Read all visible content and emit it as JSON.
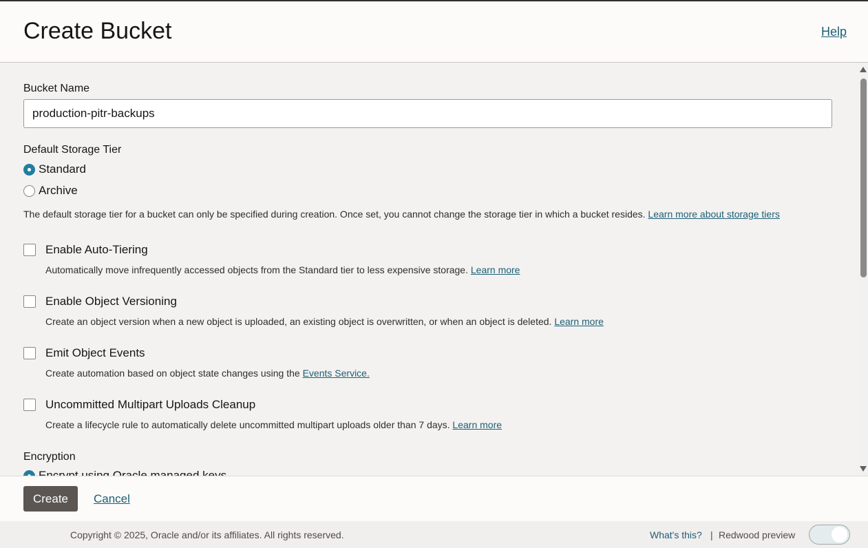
{
  "header": {
    "title": "Create Bucket",
    "help_label": "Help"
  },
  "form": {
    "bucket_name_label": "Bucket Name",
    "bucket_name_value": "production-pitr-backups",
    "storage_tier": {
      "label": "Default Storage Tier",
      "options": [
        {
          "label": "Standard",
          "selected": true
        },
        {
          "label": "Archive",
          "selected": false
        }
      ],
      "help_text": "The default storage tier for a bucket can only be specified during creation. Once set, you cannot change the storage tier in which a bucket resides.",
      "help_link": "Learn more about storage tiers"
    },
    "options": [
      {
        "label": "Enable Auto-Tiering",
        "checked": false,
        "description": "Automatically move infrequently accessed objects from the Standard tier to less expensive storage.",
        "link": "Learn more"
      },
      {
        "label": "Enable Object Versioning",
        "checked": false,
        "description": "Create an object version when a new object is uploaded, an existing object is overwritten, or when an object is deleted.",
        "link": "Learn more"
      },
      {
        "label": "Emit Object Events",
        "checked": false,
        "description": "Create automation based on object state changes using the",
        "link": "Events Service."
      },
      {
        "label": "Uncommitted Multipart Uploads Cleanup",
        "checked": false,
        "description": "Create a lifecycle rule to automatically delete uncommitted multipart uploads older than 7 days.",
        "link": "Learn more"
      }
    ],
    "encryption": {
      "label": "Encryption",
      "options": [
        {
          "label": "Encrypt using Oracle managed keys",
          "selected": true
        }
      ]
    }
  },
  "actions": {
    "create_label": "Create",
    "cancel_label": "Cancel"
  },
  "footer": {
    "copyright": "Copyright © 2025, Oracle and/or its affiliates. All rights reserved.",
    "whats_this": "What's this?",
    "separator": "|",
    "redwood_label": "Redwood preview"
  },
  "colors": {
    "accent": "#227e9e",
    "link": "#1c5e76",
    "primary_button": "#5b5652"
  }
}
